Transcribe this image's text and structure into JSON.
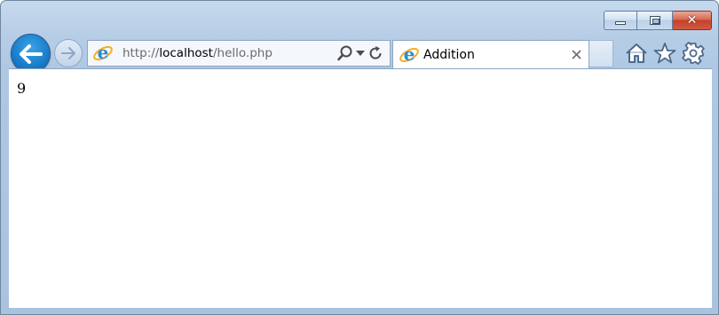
{
  "window": {
    "caption_buttons": [
      "minimize",
      "maximize",
      "close"
    ]
  },
  "navigation": {
    "back_icon": "back-arrow-icon",
    "forward_icon": "forward-arrow-icon"
  },
  "address_bar": {
    "url_prefix": "http://",
    "url_host": "localhost",
    "url_path": "/hello.php",
    "icons": [
      "ie-page-icon",
      "search-icon",
      "dropdown-icon",
      "refresh-icon"
    ]
  },
  "tabs": [
    {
      "title": "Addition",
      "active": true,
      "icon": "ie-page-icon"
    }
  ],
  "toolbar": {
    "icons": [
      "home-icon",
      "favorites-star-icon",
      "tools-gear-icon"
    ]
  },
  "page": {
    "body_text": "9"
  },
  "colors": {
    "frame": "#b7cde6",
    "back_button": "#1b7fcc",
    "close_button": "#c4402a"
  }
}
